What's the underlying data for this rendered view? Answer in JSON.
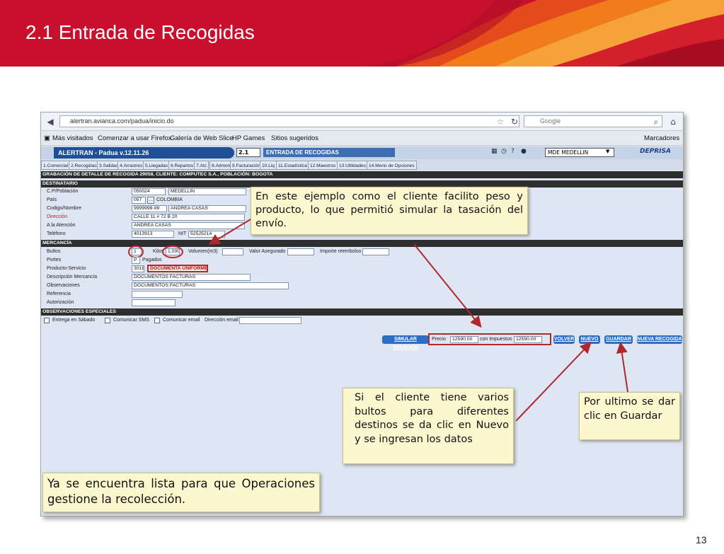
{
  "slide": {
    "title": "2.1 Entrada de Recogidas",
    "page_number": "13"
  },
  "browser": {
    "url": "alertran.avianca.com/padua/inicio.do",
    "search_placeholder": "Google",
    "bookmarks": [
      "Más visitados",
      "Comenzar a usar Firefox",
      "Galería de Web Slice",
      "HP Games",
      "Sitios sugeridos"
    ],
    "bookmarks_menu": "Marcadores"
  },
  "app": {
    "title": "ALERTRAN - Padua  v.12.11.26",
    "module_code": "2.1",
    "module_name": "ENTRADA DE RECOGIDAS",
    "office": "MDE MEDELLIN",
    "brand": "DEPRISA",
    "menu": [
      "1.Comercial",
      "2.Recogidas",
      "3.Salidas",
      "4.Arrastres",
      "5.Llegadas",
      "6.Repartos",
      "7.Atc",
      "8.Admon",
      "9.Facturación",
      "10.Liq",
      "11.Estadística",
      "12.Maestros",
      "13.Utilidades",
      "14.Menú de Opciones"
    ]
  },
  "form": {
    "header": "GRABACIÓN DE DETALLE DE RECOGIDA 29058, CLIENTE: COMPUTEC S.A., POBLACIÓN: BOGOTA",
    "destinatario": {
      "section": "DESTINATARIO",
      "cp_label": "C.P/Población",
      "cp_code": "050024",
      "cp_city": "MEDELLIN",
      "pais_label": "País",
      "pais_code": "057",
      "pais_name": "COLOMBIA",
      "codigo_label": "Codigo/Nombre",
      "codigo": "9999999-99",
      "nombre": "ANDREA CASAS",
      "direccion_label": "Dirección",
      "direccion": "CALLE 11 # 72 B 20",
      "atencion_label": "A la Atención",
      "atencion": "ANDREA CASAS",
      "telefono_label": "Teléfono",
      "telefono": "4013913",
      "nit_label": "NIT",
      "nit": "52525214"
    },
    "mercancia": {
      "section": "MERCANCÍA",
      "bultos_label": "Bultos",
      "bultos": "1",
      "kilos_label": "Kilos",
      "kilos": "1,000",
      "volumen_label": "Volumen(m3)",
      "valor_label": "Valor Asegurado",
      "importe_label": "Importe reembolso",
      "portes_label": "Portes",
      "portes_code": "P",
      "portes_value": "Pagados",
      "producto_label": "Producto-Servicio",
      "producto_code": "3018",
      "producto_name": "DOCUMENTA UNIFORME",
      "descripcion_label": "Descripción Mercancía",
      "descripcion": "DOCUMENTOS FACTURAS",
      "observaciones_label": "Observaciones",
      "observaciones": "DOCUMENTOS FACTURAS",
      "referencia_label": "Referencia",
      "autorizacion_label": "Autorización"
    },
    "observaciones_especiales": {
      "section": "OBSERVACIONES ESPECIALES",
      "entrega_sabado": "Entrega en Sábado",
      "comunicar_sms": "Comunicar SMS",
      "comunicar_email": "Comunicar email",
      "direccion_email": "Dirección email"
    },
    "actions": {
      "simular": "SIMULAR TASACIÓN",
      "precio_label": "Precio",
      "precio": "12590.00",
      "impuestos_label": "con Impuestos",
      "impuestos": "12590.00",
      "volver": "VOLVER",
      "nuevo": "NUEVO",
      "guardar": "GUARDAR",
      "nueva_recogida": "NUEVA RECOGIDA"
    }
  },
  "callouts": {
    "top": "En este ejemplo como el cliente facilito peso y producto, lo que permitió simular la tasación del envío.",
    "nuevo": "Si el cliente tiene varios bultos para diferentes destinos se da clic en Nuevo y se ingresan los datos",
    "guardar": "Por ultimo se dar clic en Guardar",
    "ready": "Ya se encuentra lista para que Operaciones gestione la recolección."
  },
  "colors": {
    "banner_red": "#c8102e",
    "banner_orange": "#f07c1a",
    "app_blue": "#1f4f96",
    "callout_bg": "#fdf7cf",
    "arrow_red": "#b0282c"
  }
}
